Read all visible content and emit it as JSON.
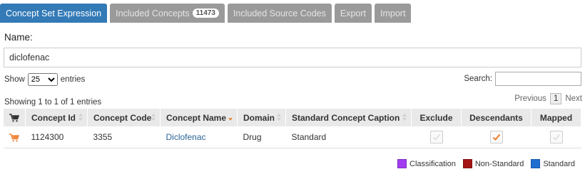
{
  "tabs": [
    {
      "label": "Concept Set Expression",
      "active": true
    },
    {
      "label": "Included Concepts",
      "badge": "11473"
    },
    {
      "label": "Included Source Codes"
    },
    {
      "label": "Export"
    },
    {
      "label": "Import"
    }
  ],
  "name": {
    "label": "Name:",
    "value": "diclofenac"
  },
  "length": {
    "show": "Show",
    "value": "25",
    "entries": "entries"
  },
  "search": {
    "label": "Search:"
  },
  "info": "Showing 1 to 1 of 1 entries",
  "pagination": {
    "previous": "Previous",
    "current": "1",
    "next": "Next"
  },
  "table": {
    "columns": [
      "Concept Id",
      "Concept Code",
      "Concept Name",
      "Domain",
      "Standard Concept Caption",
      "Exclude",
      "Descendants",
      "Mapped"
    ],
    "rows": [
      {
        "concept_id": "1124300",
        "concept_code": "3355",
        "concept_name": "Diclofenac",
        "domain": "Drug",
        "caption": "Standard",
        "exclude": false,
        "descendants": true,
        "mapped": false
      }
    ]
  },
  "legend": [
    {
      "label": "Classification",
      "color": "#a23cf0"
    },
    {
      "label": "Non-Standard",
      "color": "#a31515"
    },
    {
      "label": "Standard",
      "color": "#1f6fd1"
    }
  ],
  "colors": {
    "accent": "#337ab7",
    "cart": "#f0883d",
    "check": "#f0883d"
  }
}
